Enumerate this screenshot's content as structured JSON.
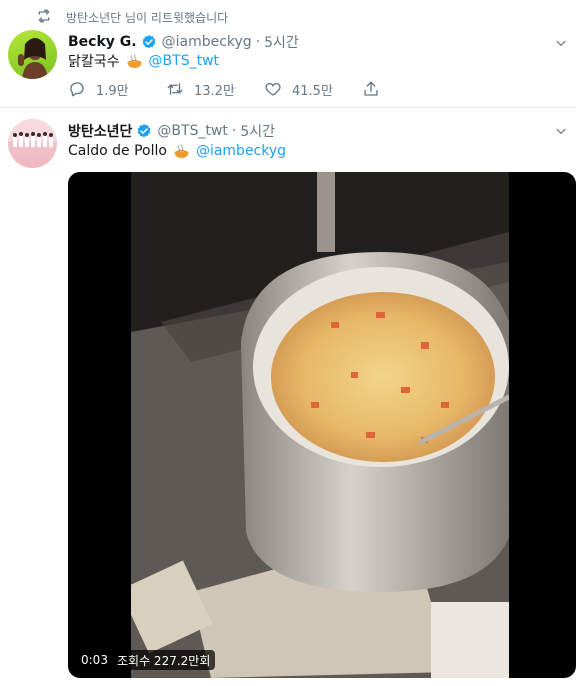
{
  "retweet_context": {
    "text": "방탄소년단 님이 리트윗했습니다"
  },
  "tweet1": {
    "name": "Becky G.",
    "handle": "@iambeckyg",
    "dot": "·",
    "time": "5시간",
    "text_before": "닭칼국수",
    "emoji": "steaming-bowl",
    "mention": "@BTS_twt",
    "actions": {
      "replies": "1.9만",
      "retweets": "13.2만",
      "likes": "41.5만"
    }
  },
  "tweet2": {
    "name": "방탄소년단",
    "handle": "@BTS_twt",
    "dot": "·",
    "time": "5시간",
    "text_before": "Caldo de Pollo",
    "emoji": "steaming-bowl",
    "mention": "@iambeckyg",
    "video": {
      "timestamp": "0:03",
      "views": "조회수 227.2만회"
    }
  },
  "colors": {
    "link": "#1da1f2",
    "secondary_text": "#657786",
    "verified": "#1da1f2",
    "divider": "#e6ecf0"
  }
}
